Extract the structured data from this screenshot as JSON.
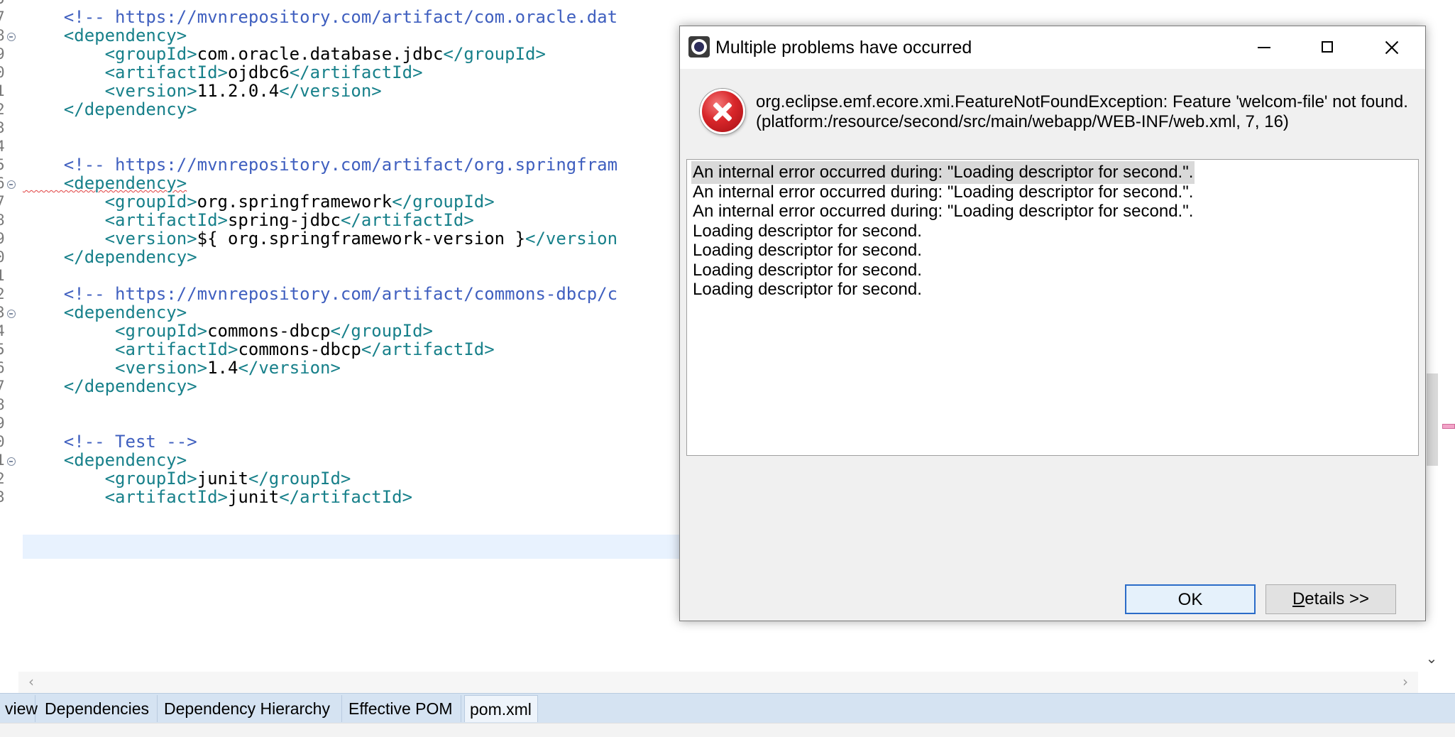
{
  "editor": {
    "line_numbers": [
      "5",
      "7",
      "8",
      "9",
      "0",
      "1",
      "2",
      "3",
      "4",
      "5",
      "6",
      "7",
      "8",
      "9",
      "0",
      "1",
      "2",
      "3",
      "4",
      "5",
      "6",
      "7",
      "8",
      "9",
      "0",
      "1",
      "2",
      "3"
    ],
    "lines": [
      [
        "",
        ""
      ],
      [
        "cm",
        "    <!-- https://mvnrepository.com/artifact/com.oracle.dat"
      ],
      [
        "tg",
        "    <dependency>"
      ],
      [
        "mix",
        "        <groupId>",
        "com.oracle.database.jdbc",
        "</groupId>"
      ],
      [
        "mix",
        "        <artifactId>",
        "ojdbc6",
        "</artifactId>"
      ],
      [
        "mix",
        "        <version>",
        "11.2.0.4",
        "</version>"
      ],
      [
        "tg",
        "    </dependency>"
      ],
      [
        "",
        ""
      ],
      [
        "",
        ""
      ],
      [
        "cm",
        "    <!-- https://mvnrepository.com/artifact/org.springfram"
      ],
      [
        "sq",
        "    <dependency>"
      ],
      [
        "mix",
        "        <groupId>",
        "org.springframework",
        "</groupId>"
      ],
      [
        "mix",
        "        <artifactId>",
        "spring-jdbc",
        "</artifactId>"
      ],
      [
        "mix",
        "        <version>",
        "${ org.springframework-version }",
        "</version"
      ],
      [
        "tg",
        "    </dependency>"
      ],
      [
        "",
        ""
      ],
      [
        "cm",
        "    <!-- https://mvnrepository.com/artifact/commons-dbcp/c"
      ],
      [
        "tg",
        "    <dependency>"
      ],
      [
        "mix",
        "         <groupId>",
        "commons-dbcp",
        "</groupId>"
      ],
      [
        "mix",
        "         <artifactId>",
        "commons-dbcp",
        "</artifactId>"
      ],
      [
        "mix",
        "         <version>",
        "1.4",
        "</version>"
      ],
      [
        "tg",
        "    </dependency>"
      ],
      [
        "",
        ""
      ],
      [
        "",
        ""
      ],
      [
        "cm",
        "    <!-- Test -->"
      ],
      [
        "tg",
        "    <dependency>"
      ],
      [
        "mix",
        "        <groupId>",
        "junit",
        "</groupId>"
      ],
      [
        "mix",
        "        <artifactId>",
        "junit",
        "</artifactId>"
      ]
    ]
  },
  "tabs": [
    "view",
    "Dependencies",
    "Dependency Hierarchy",
    "Effective POM",
    "pom.xml"
  ],
  "dialog": {
    "title": "Multiple problems have occurred",
    "message_line1": "org.eclipse.emf.ecore.xmi.FeatureNotFoundException: Feature 'welcom-file' not found.",
    "message_line2": "(platform:/resource/second/src/main/webapp/WEB-INF/web.xml, 7, 16)",
    "problems": [
      "An internal error occurred during: \"Loading descriptor for second.\".",
      "An internal error occurred during: \"Loading descriptor for second.\".",
      "An internal error occurred during: \"Loading descriptor for second.\".",
      "Loading descriptor for second.",
      "Loading descriptor for second.",
      "Loading descriptor for second.",
      "Loading descriptor for second."
    ],
    "ok_label": "OK",
    "details_label_underlined": "D",
    "details_label_rest": "etails >>"
  }
}
